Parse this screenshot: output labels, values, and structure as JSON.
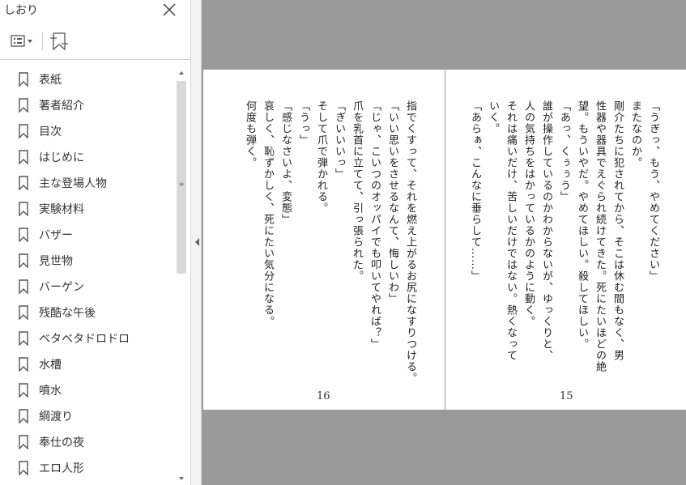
{
  "sidebar": {
    "title": "しおり",
    "items": [
      {
        "label": "表紙"
      },
      {
        "label": "著者紹介"
      },
      {
        "label": "目次"
      },
      {
        "label": "はじめに"
      },
      {
        "label": "主な登場人物"
      },
      {
        "label": "実験材料"
      },
      {
        "label": "バザー"
      },
      {
        "label": "見世物"
      },
      {
        "label": "バーゲン"
      },
      {
        "label": "残酷な午後"
      },
      {
        "label": "ベタベタドロドロ"
      },
      {
        "label": "水槽"
      },
      {
        "label": "噴水"
      },
      {
        "label": "綱渡り"
      },
      {
        "label": "奉仕の夜"
      },
      {
        "label": "エロ人形"
      }
    ]
  },
  "pages": {
    "left": {
      "number": "16",
      "text": "指でくすって、それを燃え上がるお尻になすりつける。\n「いい思いをさせるなんて、悔しいわ」\n「じゃ、こいつのオッパイでも叩いてやれば？」\n爪を乳首に立てて、引っ張られた。\n「ぎいいいっ」\nそして爪で弾かれる。\n「うっ」\n「感じなさいよ、変態」\n哀しく、恥ずかしく、死にたい気分になる。\n何度も弾く。"
    },
    "right": {
      "number": "15",
      "text": "「うぎっ、もう、やめてください」\nまたなのか。\n剛介たちに犯されてから、そこは休む間もなく、男\n性器や器具でえぐられ続けてきた。死にたいほどの絶\n望。もういやだ。やめてほしい。殺してほしい。\n「あっ、くぅぅう」\n誰が操作しているのかわからないが、ゆっくりと、\n人の気持ちをはかっているかのように動く。\nそれは痛いだけ、苦しいだけではない。熱くなって\nいく。\n「あらぁ、こんなに垂らして……」"
    }
  }
}
